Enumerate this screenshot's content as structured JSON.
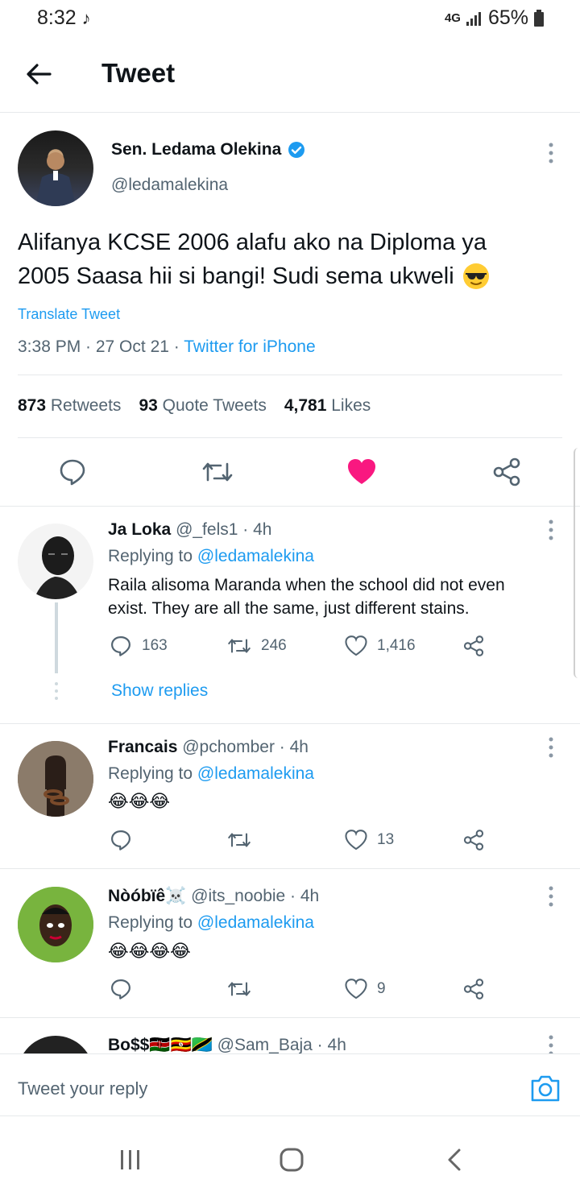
{
  "status_bar": {
    "time": "8:32",
    "network": "4G",
    "battery": "65%"
  },
  "header": {
    "title": "Tweet"
  },
  "tweet": {
    "author_name": "Sen. Ledama Olekina",
    "author_handle": "@ledamalekina",
    "text_line1": "Alifanya KCSE 2006 alafu ako na Diploma ya",
    "text_line2": "2005 Saasa hii si bangi! Sudi sema ukweli",
    "translate": "Translate Tweet",
    "timestamp": "3:38 PM · 27 Oct 21 · ",
    "source": "Twitter for iPhone",
    "retweets_count": "873",
    "retweets_label": "Retweets",
    "quotes_count": "93",
    "quotes_label": "Quote Tweets",
    "likes_count": "4,781",
    "likes_label": "Likes",
    "liked": true
  },
  "replies": [
    {
      "name": "Ja Loka",
      "handle": "@_fels1 · 4h",
      "replying_prefix": "Replying to ",
      "replying_to": "@ledamalekina",
      "text": "Raila alisoma Maranda when the school did not even exist. They are all the same, just different stains.",
      "reply_count": "163",
      "retweet_count": "246",
      "like_count": "1,416",
      "show_replies": "Show replies"
    },
    {
      "name": "Francais",
      "handle": "@pchomber · 4h",
      "replying_prefix": "Replying to ",
      "replying_to": "@ledamalekina",
      "text": "😂😂😂",
      "reply_count": "",
      "retweet_count": "",
      "like_count": "13"
    },
    {
      "name": "Nòóbïê☠️",
      "handle": "@its_noobie · 4h",
      "replying_prefix": "Replying to ",
      "replying_to": "@ledamalekina",
      "text": "😂😂😂😂",
      "reply_count": "",
      "retweet_count": "",
      "like_count": "9"
    },
    {
      "name": "Bo$$🇰🇪🇺🇬🇹🇿",
      "handle": "@Sam_Baja · 4h"
    }
  ],
  "reply_bar": {
    "placeholder": "Tweet your reply"
  },
  "colors": {
    "accent": "#1d9bf0",
    "like": "#f91880",
    "text": "#0f1419",
    "secondary": "#536471"
  }
}
